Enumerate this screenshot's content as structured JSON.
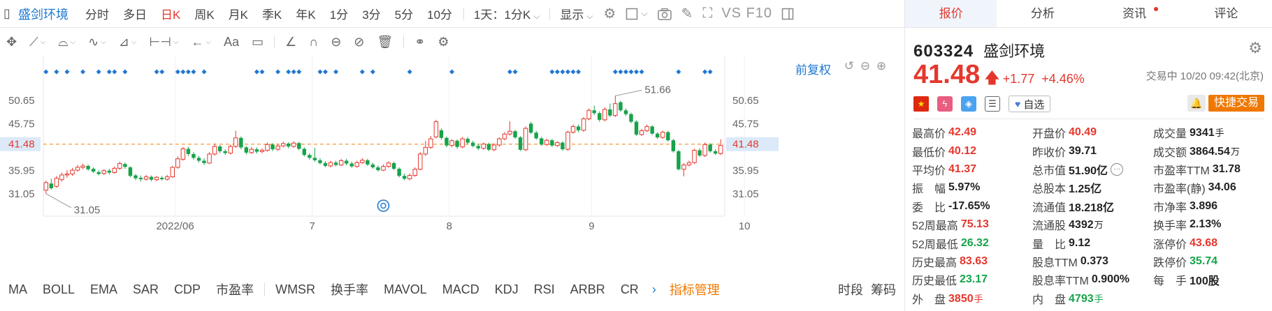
{
  "toolbar": {
    "stock_name": "盛剑环境",
    "periods": [
      {
        "label": "分时",
        "active": false
      },
      {
        "label": "多日",
        "active": false
      },
      {
        "label": "日K",
        "active": true
      },
      {
        "label": "周K",
        "active": false
      },
      {
        "label": "月K",
        "active": false
      },
      {
        "label": "季K",
        "active": false
      },
      {
        "label": "年K",
        "active": false
      },
      {
        "label": "1分",
        "active": false
      },
      {
        "label": "3分",
        "active": false
      },
      {
        "label": "5分",
        "active": false
      },
      {
        "label": "10分",
        "active": false
      }
    ],
    "range_select": "1天：1分K",
    "display_label": "显示",
    "vs_f10": "VS F10"
  },
  "draw_tools": [
    "move-icon",
    "line-icon",
    "polyline-icon",
    "wave-icon",
    "fib-icon",
    "range-icon",
    "arrow-icon",
    "text-icon",
    "note-icon",
    "pencil-icon",
    "magnet-icon",
    "lock-icon",
    "hide-icon",
    "trash-icon",
    "link-icon",
    "settings-icon"
  ],
  "draw_text_label": "Aa",
  "chart_data": {
    "type": "candlestick",
    "price_ticks": [
      "50.65",
      "45.75",
      "41.48",
      "35.95",
      "31.05"
    ],
    "current_price_label": "41.48",
    "current_price": 41.48,
    "x_labels": [
      "2022/06",
      "7",
      "8",
      "9",
      "10"
    ],
    "annotation_high": "51.66",
    "annotation_low": "31.05",
    "restore_label": "前复权",
    "y_range": [
      27.5,
      54.5
    ],
    "color_up": "#e5372d",
    "color_down": "#16a34a",
    "candles": [
      {
        "o": 31.8,
        "c": 33.4,
        "h": 33.8,
        "l": 31.05
      },
      {
        "o": 33.2,
        "c": 32.2,
        "h": 34.2,
        "l": 31.9
      },
      {
        "o": 32.6,
        "c": 34.3,
        "h": 34.8,
        "l": 32.3
      },
      {
        "o": 34.0,
        "c": 35.0,
        "h": 35.5,
        "l": 33.6
      },
      {
        "o": 35.0,
        "c": 35.2,
        "h": 36.0,
        "l": 34.4
      },
      {
        "o": 35.2,
        "c": 36.0,
        "h": 36.5,
        "l": 34.8
      },
      {
        "o": 36.0,
        "c": 36.6,
        "h": 37.1,
        "l": 35.7
      },
      {
        "o": 36.6,
        "c": 36.9,
        "h": 37.4,
        "l": 36.2
      },
      {
        "o": 36.9,
        "c": 36.2,
        "h": 37.2,
        "l": 35.9
      },
      {
        "o": 36.3,
        "c": 35.7,
        "h": 36.6,
        "l": 35.4
      },
      {
        "o": 35.6,
        "c": 35.2,
        "h": 36.0,
        "l": 34.9
      },
      {
        "o": 35.3,
        "c": 35.9,
        "h": 36.2,
        "l": 35.0
      },
      {
        "o": 35.9,
        "c": 35.5,
        "h": 36.3,
        "l": 35.1
      },
      {
        "o": 35.5,
        "c": 36.4,
        "h": 36.8,
        "l": 35.3
      },
      {
        "o": 36.4,
        "c": 37.4,
        "h": 37.8,
        "l": 36.1
      },
      {
        "o": 37.3,
        "c": 36.7,
        "h": 37.6,
        "l": 36.3
      },
      {
        "o": 36.6,
        "c": 34.8,
        "h": 36.8,
        "l": 34.5
      },
      {
        "o": 34.9,
        "c": 34.3,
        "h": 35.2,
        "l": 33.9
      },
      {
        "o": 34.4,
        "c": 34.1,
        "h": 34.9,
        "l": 33.6
      },
      {
        "o": 34.1,
        "c": 34.6,
        "h": 35.0,
        "l": 33.8
      },
      {
        "o": 34.6,
        "c": 34.0,
        "h": 34.9,
        "l": 33.7
      },
      {
        "o": 34.0,
        "c": 34.5,
        "h": 34.8,
        "l": 33.7
      },
      {
        "o": 34.4,
        "c": 34.1,
        "h": 34.8,
        "l": 33.8
      },
      {
        "o": 34.1,
        "c": 34.6,
        "h": 35.0,
        "l": 33.8
      },
      {
        "o": 34.6,
        "c": 36.6,
        "h": 36.9,
        "l": 34.4
      },
      {
        "o": 36.6,
        "c": 38.4,
        "h": 38.9,
        "l": 36.3
      },
      {
        "o": 38.3,
        "c": 40.5,
        "h": 40.9,
        "l": 38.0
      },
      {
        "o": 40.5,
        "c": 39.4,
        "h": 40.9,
        "l": 39.0
      },
      {
        "o": 39.4,
        "c": 38.6,
        "h": 39.8,
        "l": 38.2
      },
      {
        "o": 38.6,
        "c": 38.0,
        "h": 39.0,
        "l": 37.6
      },
      {
        "o": 38.0,
        "c": 37.5,
        "h": 38.5,
        "l": 37.1
      },
      {
        "o": 37.5,
        "c": 39.4,
        "h": 39.8,
        "l": 37.3
      },
      {
        "o": 39.4,
        "c": 41.0,
        "h": 41.6,
        "l": 39.1
      },
      {
        "o": 41.0,
        "c": 40.0,
        "h": 41.3,
        "l": 39.6
      },
      {
        "o": 40.0,
        "c": 39.6,
        "h": 40.4,
        "l": 39.2
      },
      {
        "o": 39.6,
        "c": 41.0,
        "h": 41.4,
        "l": 39.3
      },
      {
        "o": 41.0,
        "c": 42.8,
        "h": 44.3,
        "l": 40.7
      },
      {
        "o": 42.8,
        "c": 40.8,
        "h": 43.1,
        "l": 40.4
      },
      {
        "o": 40.8,
        "c": 39.7,
        "h": 41.1,
        "l": 39.3
      },
      {
        "o": 39.7,
        "c": 40.4,
        "h": 40.9,
        "l": 39.4
      },
      {
        "o": 40.4,
        "c": 39.9,
        "h": 40.8,
        "l": 39.5
      },
      {
        "o": 39.9,
        "c": 40.2,
        "h": 40.6,
        "l": 39.6
      },
      {
        "o": 40.2,
        "c": 41.4,
        "h": 41.8,
        "l": 39.9
      },
      {
        "o": 41.4,
        "c": 40.4,
        "h": 41.7,
        "l": 40.0
      },
      {
        "o": 40.4,
        "c": 41.1,
        "h": 41.5,
        "l": 40.1
      },
      {
        "o": 41.1,
        "c": 41.6,
        "h": 42.0,
        "l": 40.8
      },
      {
        "o": 41.6,
        "c": 41.0,
        "h": 41.9,
        "l": 40.6
      },
      {
        "o": 41.0,
        "c": 41.7,
        "h": 42.1,
        "l": 40.7
      },
      {
        "o": 41.7,
        "c": 40.5,
        "h": 42.0,
        "l": 40.2
      },
      {
        "o": 40.5,
        "c": 39.2,
        "h": 40.8,
        "l": 38.9
      },
      {
        "o": 39.2,
        "c": 38.6,
        "h": 39.6,
        "l": 38.2
      },
      {
        "o": 38.6,
        "c": 38.1,
        "h": 40.7,
        "l": 37.8
      },
      {
        "o": 38.1,
        "c": 37.5,
        "h": 38.5,
        "l": 37.2
      },
      {
        "o": 37.5,
        "c": 36.9,
        "h": 37.9,
        "l": 36.6
      },
      {
        "o": 36.9,
        "c": 37.6,
        "h": 38.0,
        "l": 36.6
      },
      {
        "o": 37.6,
        "c": 37.1,
        "h": 38.0,
        "l": 36.8
      },
      {
        "o": 37.1,
        "c": 38.0,
        "h": 38.4,
        "l": 36.9
      },
      {
        "o": 38.0,
        "c": 37.4,
        "h": 38.4,
        "l": 37.0
      },
      {
        "o": 37.4,
        "c": 36.8,
        "h": 37.8,
        "l": 36.5
      },
      {
        "o": 36.8,
        "c": 37.6,
        "h": 38.0,
        "l": 36.5
      },
      {
        "o": 37.6,
        "c": 38.1,
        "h": 38.5,
        "l": 37.3
      },
      {
        "o": 38.1,
        "c": 37.2,
        "h": 38.4,
        "l": 36.9
      },
      {
        "o": 37.2,
        "c": 36.6,
        "h": 37.6,
        "l": 36.3
      },
      {
        "o": 36.6,
        "c": 36.0,
        "h": 37.0,
        "l": 35.7
      },
      {
        "o": 36.0,
        "c": 36.8,
        "h": 37.2,
        "l": 35.8
      },
      {
        "o": 36.8,
        "c": 37.5,
        "h": 37.9,
        "l": 36.5
      },
      {
        "o": 37.5,
        "c": 36.3,
        "h": 37.8,
        "l": 36.0
      },
      {
        "o": 36.3,
        "c": 34.8,
        "h": 36.6,
        "l": 34.5
      },
      {
        "o": 34.8,
        "c": 34.2,
        "h": 35.3,
        "l": 33.9
      },
      {
        "o": 34.2,
        "c": 34.9,
        "h": 35.3,
        "l": 33.9
      },
      {
        "o": 34.9,
        "c": 36.2,
        "h": 36.6,
        "l": 34.6
      },
      {
        "o": 36.2,
        "c": 39.4,
        "h": 39.8,
        "l": 36.0
      },
      {
        "o": 39.4,
        "c": 40.8,
        "h": 42.2,
        "l": 39.0
      },
      {
        "o": 40.8,
        "c": 42.6,
        "h": 43.2,
        "l": 40.5
      },
      {
        "o": 43.0,
        "c": 46.2,
        "h": 46.6,
        "l": 42.7
      },
      {
        "o": 44.4,
        "c": 42.8,
        "h": 44.8,
        "l": 42.4
      },
      {
        "o": 42.8,
        "c": 41.2,
        "h": 43.1,
        "l": 40.8
      },
      {
        "o": 41.2,
        "c": 42.2,
        "h": 42.5,
        "l": 40.8
      },
      {
        "o": 42.2,
        "c": 40.9,
        "h": 42.5,
        "l": 40.5
      },
      {
        "o": 40.9,
        "c": 42.6,
        "h": 43.0,
        "l": 40.6
      },
      {
        "o": 42.6,
        "c": 41.8,
        "h": 43.0,
        "l": 41.4
      },
      {
        "o": 41.8,
        "c": 41.1,
        "h": 42.2,
        "l": 40.8
      },
      {
        "o": 41.1,
        "c": 40.6,
        "h": 41.5,
        "l": 40.2
      },
      {
        "o": 40.6,
        "c": 41.5,
        "h": 41.8,
        "l": 40.3
      },
      {
        "o": 41.5,
        "c": 40.3,
        "h": 41.8,
        "l": 40.0
      },
      {
        "o": 40.3,
        "c": 41.3,
        "h": 41.7,
        "l": 40.0
      },
      {
        "o": 41.3,
        "c": 42.6,
        "h": 42.9,
        "l": 41.0
      },
      {
        "o": 42.6,
        "c": 43.6,
        "h": 44.0,
        "l": 42.3
      },
      {
        "o": 43.6,
        "c": 44.2,
        "h": 46.3,
        "l": 43.3
      },
      {
        "o": 44.2,
        "c": 42.9,
        "h": 44.5,
        "l": 42.6
      },
      {
        "o": 42.9,
        "c": 40.3,
        "h": 43.2,
        "l": 40.0
      },
      {
        "o": 40.3,
        "c": 44.8,
        "h": 45.2,
        "l": 40.0
      },
      {
        "o": 45.8,
        "c": 43.9,
        "h": 46.2,
        "l": 43.6
      },
      {
        "o": 43.9,
        "c": 42.7,
        "h": 44.3,
        "l": 42.4
      },
      {
        "o": 42.7,
        "c": 41.4,
        "h": 43.0,
        "l": 41.1
      },
      {
        "o": 41.4,
        "c": 42.3,
        "h": 42.6,
        "l": 41.1
      },
      {
        "o": 42.3,
        "c": 41.2,
        "h": 42.6,
        "l": 40.9
      },
      {
        "o": 41.2,
        "c": 41.8,
        "h": 42.1,
        "l": 40.9
      },
      {
        "o": 41.8,
        "c": 40.4,
        "h": 42.1,
        "l": 40.1
      },
      {
        "o": 40.4,
        "c": 44.0,
        "h": 44.3,
        "l": 40.1
      },
      {
        "o": 44.0,
        "c": 45.2,
        "h": 45.6,
        "l": 43.7
      },
      {
        "o": 45.2,
        "c": 44.4,
        "h": 45.6,
        "l": 44.0
      },
      {
        "o": 44.4,
        "c": 46.8,
        "h": 47.2,
        "l": 44.1
      },
      {
        "o": 46.8,
        "c": 48.6,
        "h": 49.0,
        "l": 46.5
      },
      {
        "o": 48.6,
        "c": 48.0,
        "h": 49.6,
        "l": 47.6
      },
      {
        "o": 48.0,
        "c": 46.6,
        "h": 48.4,
        "l": 46.2
      },
      {
        "o": 46.6,
        "c": 48.8,
        "h": 49.2,
        "l": 46.3
      },
      {
        "o": 48.8,
        "c": 47.5,
        "h": 50.0,
        "l": 47.2
      },
      {
        "o": 47.5,
        "c": 50.0,
        "h": 51.66,
        "l": 47.2
      },
      {
        "o": 50.3,
        "c": 48.6,
        "h": 50.6,
        "l": 48.3
      },
      {
        "o": 48.6,
        "c": 47.8,
        "h": 49.0,
        "l": 47.4
      },
      {
        "o": 47.8,
        "c": 46.2,
        "h": 48.1,
        "l": 45.9
      },
      {
        "o": 46.2,
        "c": 43.5,
        "h": 46.5,
        "l": 43.2
      },
      {
        "o": 43.5,
        "c": 44.3,
        "h": 44.7,
        "l": 43.2
      },
      {
        "o": 44.3,
        "c": 45.2,
        "h": 45.6,
        "l": 44.0
      },
      {
        "o": 45.2,
        "c": 43.7,
        "h": 45.5,
        "l": 43.4
      },
      {
        "o": 43.7,
        "c": 42.9,
        "h": 44.0,
        "l": 42.6
      },
      {
        "o": 42.9,
        "c": 44.0,
        "h": 44.3,
        "l": 42.6
      },
      {
        "o": 44.0,
        "c": 42.3,
        "h": 44.3,
        "l": 42.0
      },
      {
        "o": 42.3,
        "c": 40.0,
        "h": 42.6,
        "l": 39.7
      },
      {
        "o": 40.0,
        "c": 36.2,
        "h": 40.3,
        "l": 35.9
      },
      {
        "o": 36.2,
        "c": 37.1,
        "h": 37.5,
        "l": 34.7
      },
      {
        "o": 37.1,
        "c": 37.6,
        "h": 38.0,
        "l": 36.8
      },
      {
        "o": 37.6,
        "c": 40.2,
        "h": 40.5,
        "l": 37.3
      },
      {
        "o": 40.2,
        "c": 39.1,
        "h": 40.6,
        "l": 38.8
      },
      {
        "o": 39.1,
        "c": 41.4,
        "h": 41.8,
        "l": 38.8
      },
      {
        "o": 41.4,
        "c": 40.0,
        "h": 41.7,
        "l": 39.7
      },
      {
        "o": 40.0,
        "c": 39.5,
        "h": 40.4,
        "l": 39.2
      },
      {
        "o": 39.5,
        "c": 41.2,
        "h": 42.49,
        "l": 39.2
      }
    ],
    "blue_marker_groups": [
      [
        0,
        2,
        4
      ],
      [
        7,
        10,
        12,
        13
      ],
      [
        15
      ],
      [
        21,
        22
      ],
      [
        25,
        26,
        27,
        28,
        30
      ],
      [
        40,
        41
      ],
      [
        44,
        46,
        47,
        48
      ],
      [
        52,
        53,
        55
      ],
      [
        60,
        62
      ],
      [
        69
      ],
      [
        77
      ],
      [
        88,
        89
      ],
      [
        96,
        97,
        98,
        99,
        100,
        101
      ],
      [
        108,
        109,
        110,
        111,
        112,
        113
      ],
      [
        120
      ],
      [
        125,
        126
      ]
    ]
  },
  "indicators": {
    "items": [
      "MA",
      "BOLL",
      "EMA",
      "SAR",
      "CDP",
      "市盈率",
      "WMSR",
      "换手率",
      "MAVOL",
      "MACD",
      "KDJ",
      "RSI",
      "ARBR",
      "CR"
    ],
    "manager_label": "指标管理",
    "right_items": [
      "时段",
      "筹码"
    ]
  },
  "panel": {
    "tabs": [
      {
        "label": "报价",
        "active": true,
        "dot": false
      },
      {
        "label": "分析",
        "active": false,
        "dot": false
      },
      {
        "label": "资讯",
        "active": false,
        "dot": true
      },
      {
        "label": "评论",
        "active": false,
        "dot": false
      }
    ],
    "code": "603324",
    "name": "盛剑环境",
    "price": "41.48",
    "change": "+1.77",
    "change_pct": "+4.46%",
    "trade_status": "交易中 10/20 09:42(北京)",
    "watch_label": "自选",
    "fast_trade_label": "快捷交易",
    "flag_icon": "china-flag-icon",
    "quotes": [
      [
        {
          "label": "最高价",
          "value": "42.49",
          "tone": "up"
        },
        {
          "label": "开盘价",
          "value": "40.49",
          "tone": "up"
        },
        {
          "label": "成交量",
          "value": "9341",
          "unit": "手",
          "tone": "plain"
        }
      ],
      [
        {
          "label": "最低价",
          "value": "40.12",
          "tone": "up"
        },
        {
          "label": "昨收价",
          "value": "39.71",
          "tone": "plain"
        },
        {
          "label": "成交额",
          "value": "3864.54",
          "unit": "万",
          "tone": "plain"
        }
      ],
      [
        {
          "label": "平均价",
          "value": "41.37",
          "tone": "up"
        },
        {
          "label": "总市值",
          "value": "51.90亿",
          "tone": "plain",
          "more": true
        },
        {
          "label": "市盈率TTM",
          "value": "31.78",
          "tone": "plain"
        }
      ],
      [
        {
          "label": "振　幅",
          "value": "5.97%",
          "tone": "plain"
        },
        {
          "label": "总股本",
          "value": "1.25亿",
          "tone": "plain"
        },
        {
          "label": "市盈率(静)",
          "value": "34.06",
          "tone": "plain"
        }
      ],
      [
        {
          "label": "委　比",
          "value": "-17.65%",
          "tone": "plain"
        },
        {
          "label": "流通值",
          "value": "18.218亿",
          "tone": "plain"
        },
        {
          "label": "市净率",
          "value": "3.896",
          "tone": "plain"
        }
      ],
      [
        {
          "label": "52周最高",
          "value": "75.13",
          "tone": "up"
        },
        {
          "label": "流通股",
          "value": "4392",
          "unit": "万",
          "tone": "plain"
        },
        {
          "label": "换手率",
          "value": "2.13%",
          "tone": "plain"
        }
      ],
      [
        {
          "label": "52周最低",
          "value": "26.32",
          "tone": "down"
        },
        {
          "label": "量　比",
          "value": "9.12",
          "tone": "plain"
        },
        {
          "label": "涨停价",
          "value": "43.68",
          "tone": "up"
        }
      ],
      [
        {
          "label": "历史最高",
          "value": "83.63",
          "tone": "up"
        },
        {
          "label": "股息TTM",
          "value": "0.373",
          "tone": "plain"
        },
        {
          "label": "跌停价",
          "value": "35.74",
          "tone": "down"
        }
      ],
      [
        {
          "label": "历史最低",
          "value": "23.17",
          "tone": "down"
        },
        {
          "label": "股息率TTM",
          "value": "0.900%",
          "tone": "plain"
        },
        {
          "label": "每　手",
          "value": "100股",
          "tone": "plain"
        }
      ],
      [
        {
          "label": "外　盘",
          "value": "3850",
          "unit": "手",
          "tone": "up"
        },
        {
          "label": "内　盘",
          "value": "4793",
          "unit": "手",
          "tone": "down"
        },
        {
          "label": "",
          "value": "",
          "tone": "plain"
        }
      ]
    ]
  }
}
